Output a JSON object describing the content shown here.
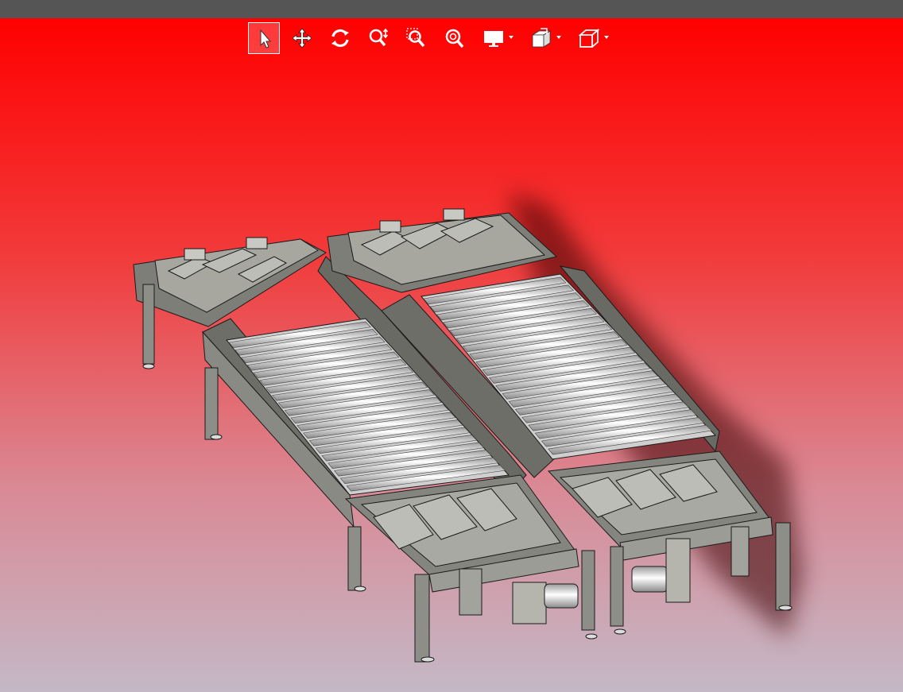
{
  "window": {
    "title": ""
  },
  "colors": {
    "titlebar": "#555555",
    "viewport_top": "#ff0000",
    "viewport_bottom": "#c4b8c6",
    "metal": "#8c8c84",
    "roller": "#e6e6e6",
    "outline": "#1a1a1a"
  },
  "toolbar": {
    "tools": [
      {
        "name": "select",
        "icon": "arrow-pointer-icon",
        "active": true
      },
      {
        "name": "pan",
        "icon": "move-arrows-icon",
        "active": false
      },
      {
        "name": "rotate",
        "icon": "rotate-icon",
        "active": false
      },
      {
        "name": "zoom",
        "icon": "zoom-icon",
        "active": false
      },
      {
        "name": "zoom-window",
        "icon": "zoom-window-icon",
        "active": false
      },
      {
        "name": "zoom-fit",
        "icon": "zoom-fit-icon",
        "active": false
      },
      {
        "name": "display",
        "icon": "monitor-icon",
        "dropdown": true
      },
      {
        "name": "section",
        "icon": "section-cube-icon",
        "dropdown": true
      },
      {
        "name": "view-cube",
        "icon": "cube-icon",
        "dropdown": true
      }
    ]
  },
  "model": {
    "description_visible": false
  }
}
